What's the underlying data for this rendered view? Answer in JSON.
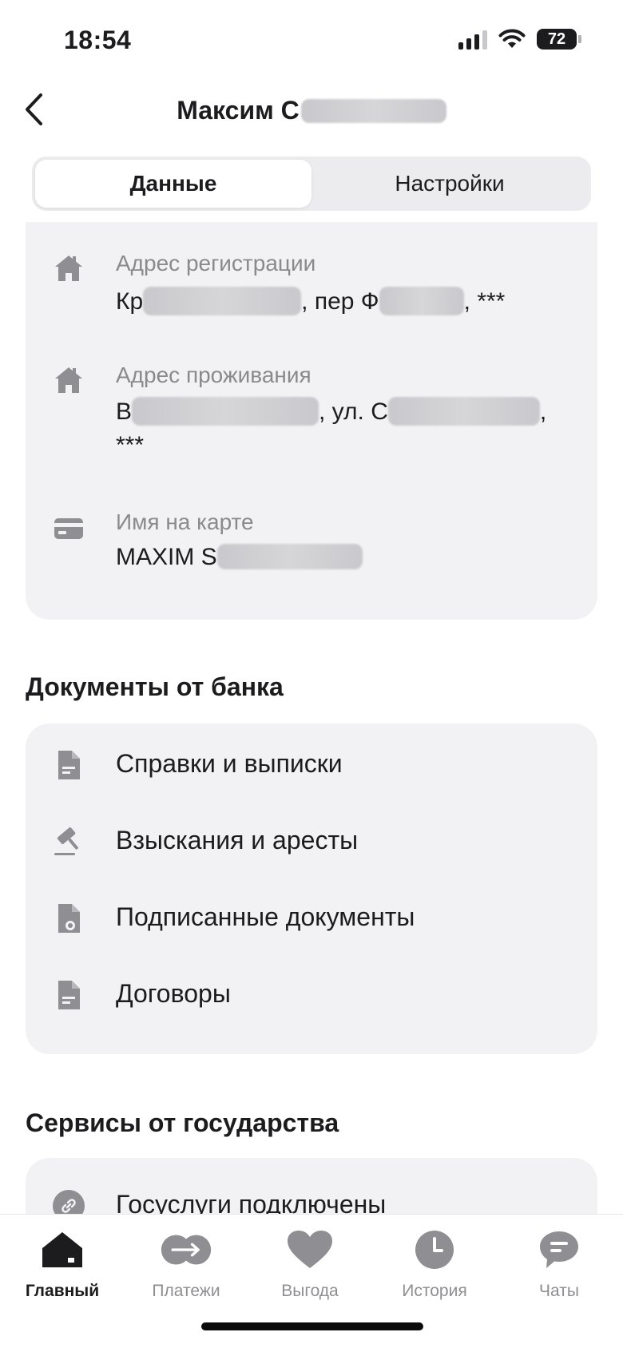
{
  "status_bar": {
    "time": "18:54",
    "battery": "72",
    "icons": [
      "cellular-signal-icon",
      "wifi-icon",
      "battery-icon"
    ]
  },
  "header": {
    "title_visible": "Максим С",
    "title_redacted": true,
    "back_icon": "chevron-left-icon"
  },
  "tabs": [
    {
      "label": "Данные",
      "active": true
    },
    {
      "label": "Настройки",
      "active": false
    }
  ],
  "personal_data": {
    "registration_address": {
      "icon": "house-icon",
      "label": "Адрес регистрации",
      "parts": [
        "Кр",
        "[redacted]",
        ", пер Ф",
        "[redacted]",
        ", ***"
      ]
    },
    "residence_address": {
      "icon": "house-icon",
      "label": "Адрес проживания",
      "parts": [
        "В",
        "[redacted]",
        ", ул. С",
        "[redacted]",
        ","
      ],
      "line2": "***"
    },
    "card_name": {
      "icon": "credit-card-icon",
      "label": "Имя на карте",
      "parts": [
        "MAXIM S",
        "[redacted]"
      ]
    }
  },
  "bank_documents": {
    "title": "Документы от банка",
    "items": [
      {
        "icon": "document-icon",
        "label": "Справки и выписки"
      },
      {
        "icon": "gavel-icon",
        "label": "Взыскания и аресты"
      },
      {
        "icon": "signed-document-icon",
        "label": "Подписанные документы"
      },
      {
        "icon": "document-icon",
        "label": "Договоры"
      }
    ]
  },
  "gov_services": {
    "title": "Сервисы от государства",
    "items": [
      {
        "icon": "link-icon",
        "label": "Госуслуги подключены"
      }
    ]
  },
  "tab_bar": {
    "items": [
      {
        "icon": "home-icon",
        "label": "Главный",
        "active": true
      },
      {
        "icon": "transfer-arrows-icon",
        "label": "Платежи",
        "active": false
      },
      {
        "icon": "heart-icon",
        "label": "Выгода",
        "active": false
      },
      {
        "icon": "clock-icon",
        "label": "История",
        "active": false
      },
      {
        "icon": "chat-bubble-icon",
        "label": "Чаты",
        "active": false
      }
    ]
  },
  "colors": {
    "card_background": "#f2f2f4",
    "icon_gray": "#8e8e93",
    "text_primary": "#1c1c1e",
    "text_secondary": "#8a8a8e"
  }
}
